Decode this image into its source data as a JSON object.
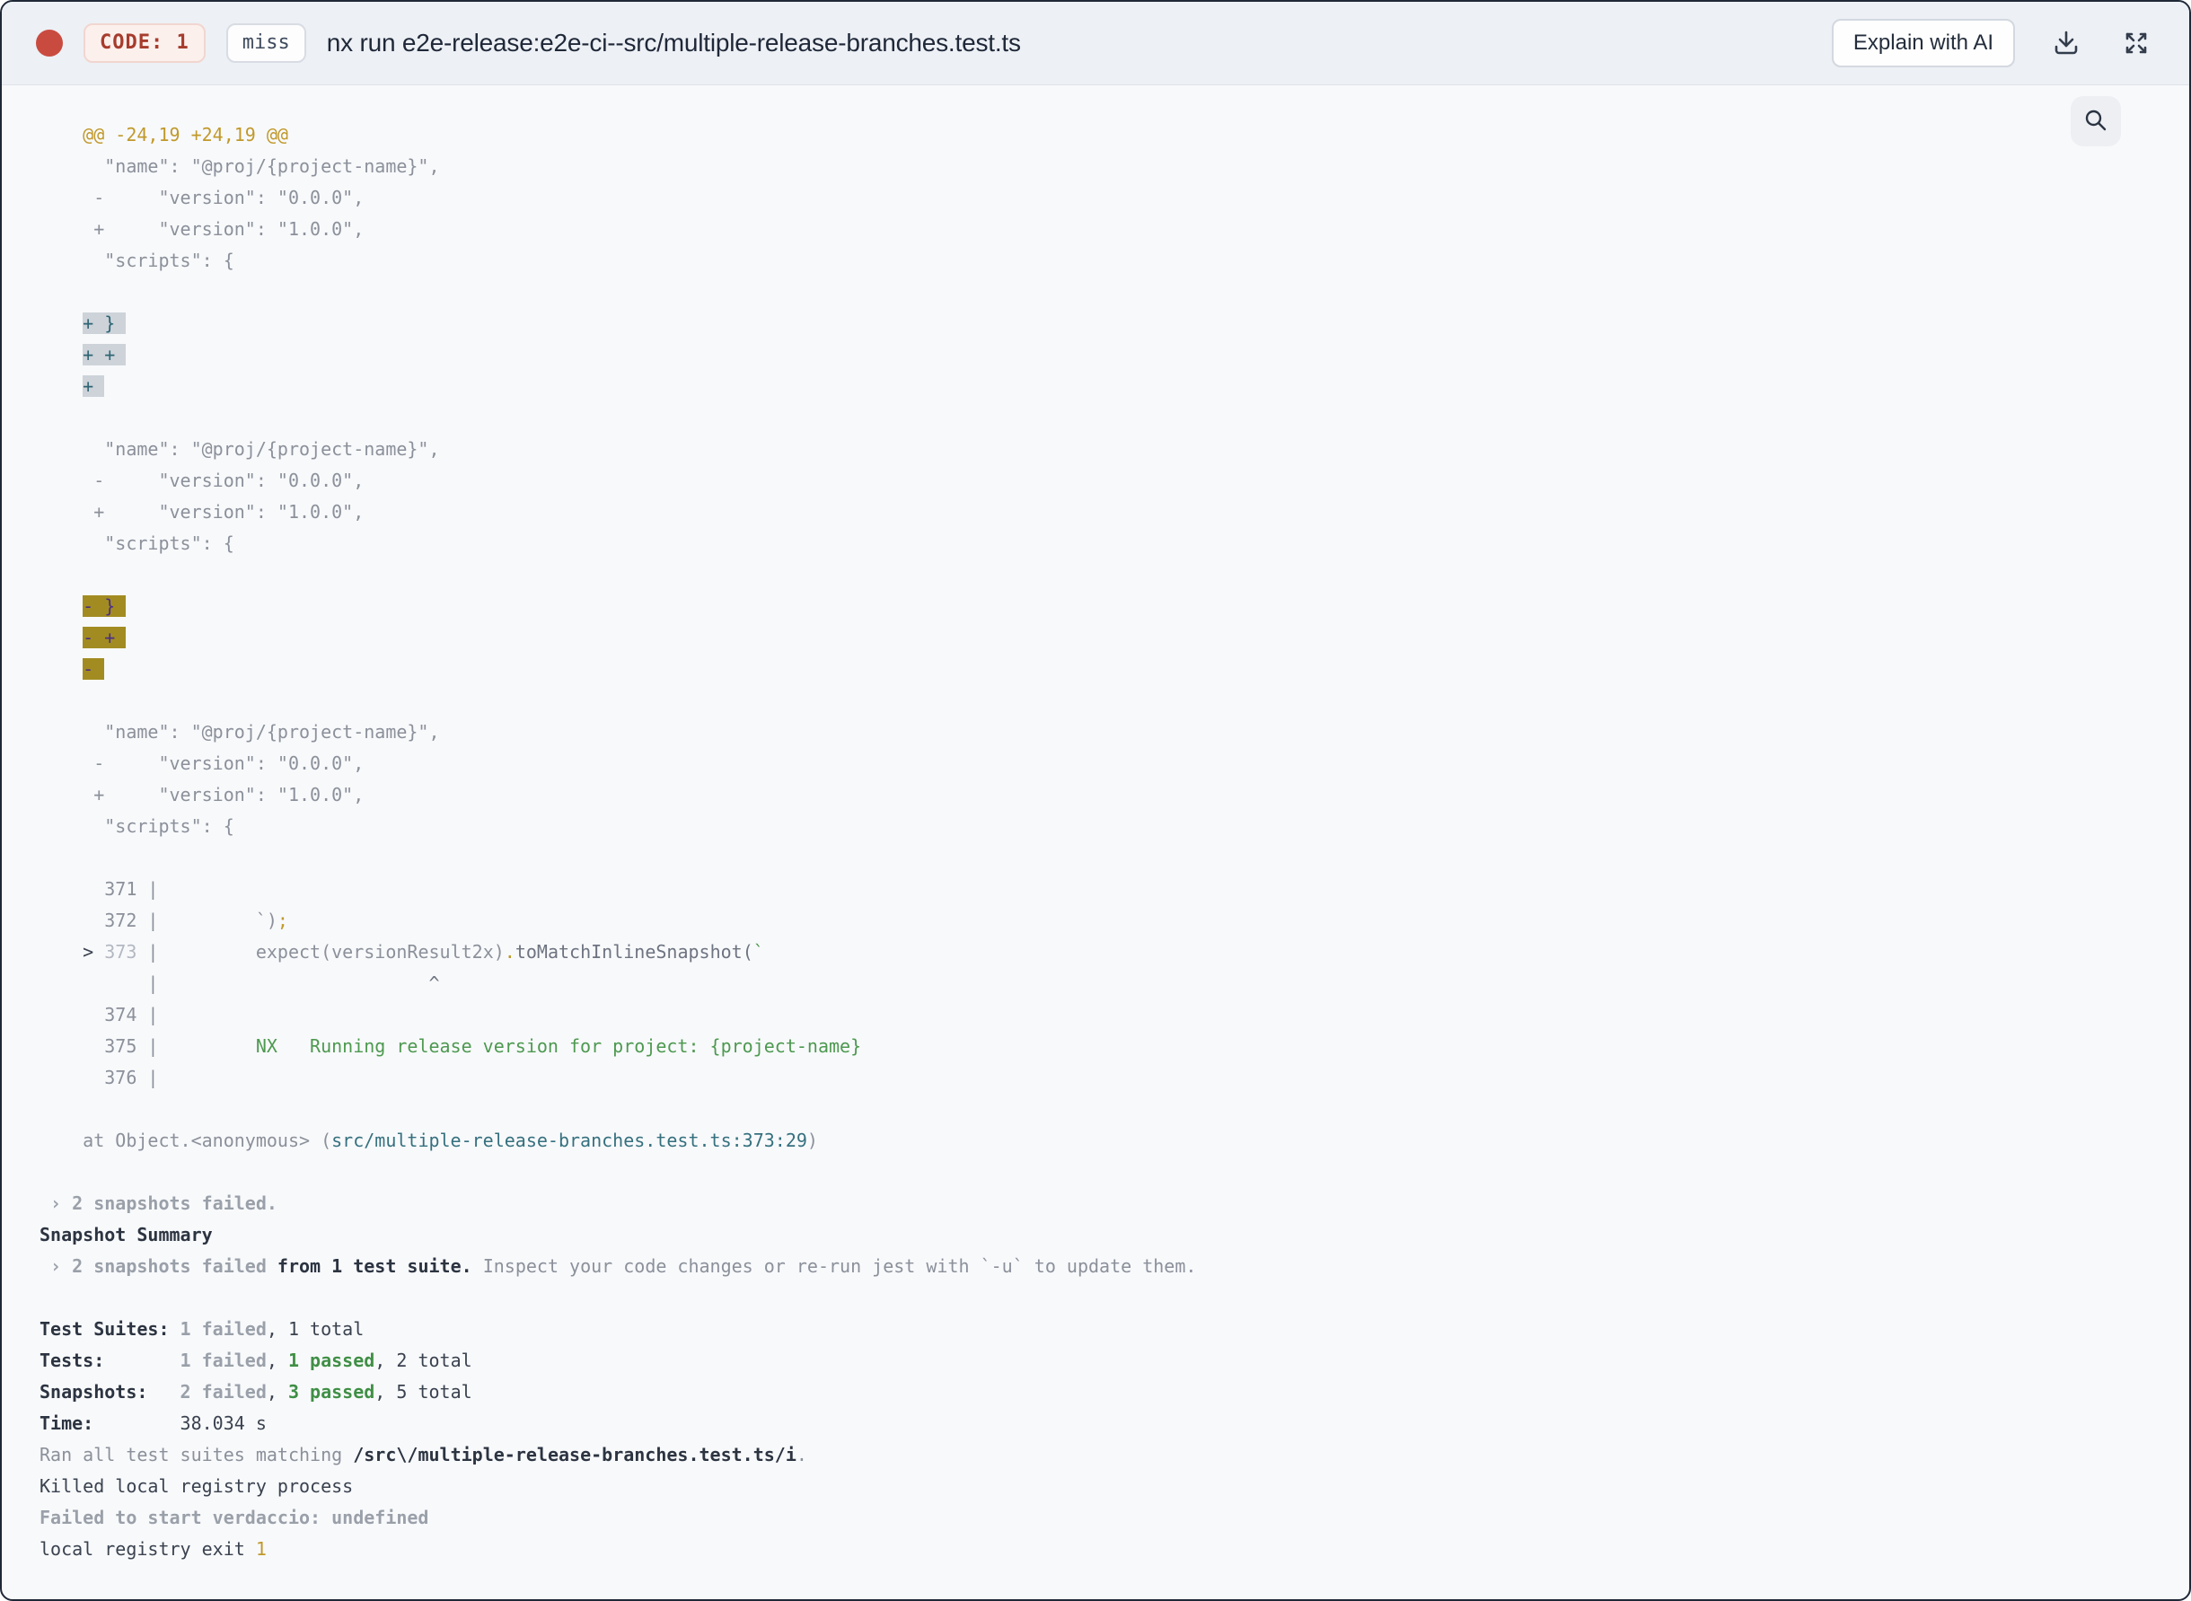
{
  "header": {
    "code_badge": "CODE: 1",
    "cache_badge": "miss",
    "title": "nx run e2e-release:e2e-ci--src/multiple-release-branches.test.ts",
    "explain_button": "Explain with AI"
  },
  "colors": {
    "status_dot": "#c94b3f",
    "code_badge_text": "#a63c2d",
    "code_badge_bg": "#fcf0ed",
    "header_bg": "#edf0f5",
    "terminal_bg": "#f8f9fb",
    "diff_header_yellow": "#c0992b",
    "success_green": "#4d9950",
    "file_link_teal": "#35707e",
    "added_highlight_bg": "#cdd3d9",
    "added_highlight_text": "#2e6474",
    "removed_highlight_bg": "#a28c21",
    "removed_highlight_text": "#4b2f83"
  },
  "terminal": {
    "lines": [
      [
        {
          "t": "    @@ -24,19 +24,19 @@",
          "c": "sy"
        }
      ],
      [
        {
          "t": "      \"name\": \"@proj/{project-name}\",",
          "c": "sg"
        }
      ],
      [
        {
          "t": "     -     \"version\": \"0.0.0\",",
          "c": "sg"
        }
      ],
      [
        {
          "t": "     +     \"version\": \"1.0.0\",",
          "c": "sg"
        }
      ],
      [
        {
          "t": "      \"scripts\": {",
          "c": "sg"
        }
      ],
      [],
      [
        {
          "t": "    ",
          "c": "sg"
        },
        {
          "t": "+ } ",
          "c": "hla"
        }
      ],
      [
        {
          "t": "    ",
          "c": "sg"
        },
        {
          "t": "+ + ",
          "c": "hla"
        }
      ],
      [
        {
          "t": "    ",
          "c": "sg"
        },
        {
          "t": "+ ",
          "c": "hla"
        }
      ],
      [],
      [
        {
          "t": "      \"name\": \"@proj/{project-name}\",",
          "c": "sg"
        }
      ],
      [
        {
          "t": "     -     \"version\": \"0.0.0\",",
          "c": "sg"
        }
      ],
      [
        {
          "t": "     +     \"version\": \"1.0.0\",",
          "c": "sg"
        }
      ],
      [
        {
          "t": "      \"scripts\": {",
          "c": "sg"
        }
      ],
      [],
      [
        {
          "t": "    ",
          "c": "sg"
        },
        {
          "t": "- } ",
          "c": "hlb"
        }
      ],
      [
        {
          "t": "    ",
          "c": "sg"
        },
        {
          "t": "- + ",
          "c": "hlb"
        }
      ],
      [
        {
          "t": "    ",
          "c": "sg"
        },
        {
          "t": "- ",
          "c": "hlb"
        }
      ],
      [],
      [
        {
          "t": "      \"name\": \"@proj/{project-name}\",",
          "c": "sg"
        }
      ],
      [
        {
          "t": "     -     \"version\": \"0.0.0\",",
          "c": "sg"
        }
      ],
      [
        {
          "t": "     +     \"version\": \"1.0.0\",",
          "c": "sg"
        }
      ],
      [
        {
          "t": "      \"scripts\": {",
          "c": "sg"
        }
      ],
      [],
      [
        {
          "t": "      371 |",
          "c": "sg"
        }
      ],
      [
        {
          "t": "      372 |         `)",
          "c": "sg"
        },
        {
          "t": ";",
          "c": "sy"
        }
      ],
      [
        {
          "t": "    > ",
          "c": "sd"
        },
        {
          "t": "373",
          "c": "sln"
        },
        {
          "t": " |         ",
          "c": "sg"
        },
        {
          "t": "expect(versionResult2x)",
          "c": "sg"
        },
        {
          "t": ".",
          "c": "sy"
        },
        {
          "t": "toMatchInlineSnapshot(",
          "c": "sd2"
        },
        {
          "t": "`",
          "c": "sgr"
        }
      ],
      [
        {
          "t": "          |                         ",
          "c": "sg"
        },
        {
          "t": "^",
          "c": "sd2"
        }
      ],
      [
        {
          "t": "      374 |",
          "c": "sg"
        }
      ],
      [
        {
          "t": "      375 |",
          "c": "sg"
        },
        {
          "t": "         NX   Running release version for project: {project-name}",
          "c": "sgr"
        }
      ],
      [
        {
          "t": "      376 |",
          "c": "sg"
        }
      ],
      [],
      [
        {
          "t": "    at Object.<anonymous> (",
          "c": "sg"
        },
        {
          "t": "src/multiple-release-branches.test.ts:373:29",
          "c": "stl"
        },
        {
          "t": ")",
          "c": "sg"
        }
      ],
      [],
      [
        {
          "t": " › 2 snapshots failed.",
          "c": "sgb"
        }
      ],
      [
        {
          "t": "Snapshot Summary",
          "c": "sdb"
        }
      ],
      [
        {
          "t": " › 2 snapshots failed",
          "c": "sgb"
        },
        {
          "t": " from 1 test suite.",
          "c": "sdb"
        },
        {
          "t": " Inspect your code changes or re-run jest with `-u` to update them.",
          "c": "sg"
        }
      ],
      [],
      [
        {
          "t": "Test Suites: ",
          "c": "sdb"
        },
        {
          "t": "1 failed",
          "c": "sgb"
        },
        {
          "t": ", 1 total",
          "c": "sd"
        }
      ],
      [
        {
          "t": "Tests:       ",
          "c": "sdb"
        },
        {
          "t": "1 failed",
          "c": "sgb"
        },
        {
          "t": ", ",
          "c": "sd"
        },
        {
          "t": "1 passed",
          "c": "sgrb"
        },
        {
          "t": ", 2 total",
          "c": "sd"
        }
      ],
      [
        {
          "t": "Snapshots:   ",
          "c": "sdb"
        },
        {
          "t": "2 failed",
          "c": "sgb"
        },
        {
          "t": ", ",
          "c": "sd"
        },
        {
          "t": "3 passed",
          "c": "sgrb"
        },
        {
          "t": ", 5 total",
          "c": "sd"
        }
      ],
      [
        {
          "t": "Time:        ",
          "c": "sdb"
        },
        {
          "t": "38.034 s",
          "c": "sd"
        }
      ],
      [
        {
          "t": "Ran all test suites matching ",
          "c": "sg"
        },
        {
          "t": "/src\\/multiple-release-branches.test.ts/i",
          "c": "sdb"
        },
        {
          "t": ".",
          "c": "sg"
        }
      ],
      [
        {
          "t": "Killed local registry process",
          "c": "sd"
        }
      ],
      [
        {
          "t": "Failed to start verdaccio: undefined",
          "c": "sgb"
        }
      ],
      [
        {
          "t": "local registry exit ",
          "c": "sd"
        },
        {
          "t": "1",
          "c": "sy"
        }
      ]
    ]
  }
}
